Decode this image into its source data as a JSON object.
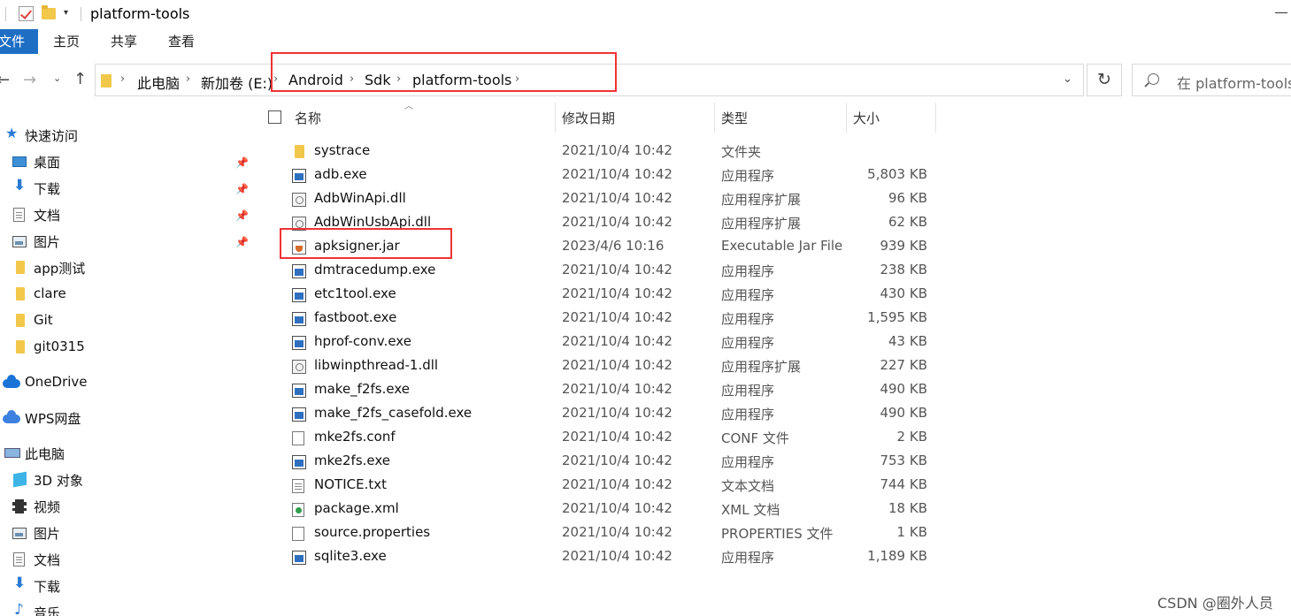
{
  "window": {
    "title": "platform-tools"
  },
  "ribbon": {
    "file": "文件",
    "home": "主页",
    "share": "共享",
    "view": "查看"
  },
  "address": {
    "crumbs": [
      "此电脑",
      "新加卷 (E:)",
      "Android",
      "Sdk",
      "platform-tools"
    ]
  },
  "search": {
    "placeholder": "在 platform-tools"
  },
  "sidebar": {
    "quick_access": "快速访问",
    "items": [
      {
        "label": "桌面"
      },
      {
        "label": "下载"
      },
      {
        "label": "文档"
      },
      {
        "label": "图片"
      },
      {
        "label": "app测试"
      },
      {
        "label": "clare"
      },
      {
        "label": "Git"
      },
      {
        "label": "git0315"
      }
    ],
    "onedrive": "OneDrive",
    "wps": "WPS网盘",
    "this_pc": "此电脑",
    "pc_items": [
      {
        "label": "3D 对象"
      },
      {
        "label": "视频"
      },
      {
        "label": "图片"
      },
      {
        "label": "文档"
      },
      {
        "label": "下载"
      },
      {
        "label": "音乐"
      }
    ]
  },
  "columns": {
    "name": "名称",
    "date": "修改日期",
    "type": "类型",
    "size": "大小"
  },
  "files": [
    {
      "name": "systrace",
      "date": "2021/10/4 10:42",
      "type": "文件夹",
      "size": "",
      "icon": "folder-icon"
    },
    {
      "name": "adb.exe",
      "date": "2021/10/4 10:42",
      "type": "应用程序",
      "size": "5,803 KB",
      "icon": "exe-icon"
    },
    {
      "name": "AdbWinApi.dll",
      "date": "2021/10/4 10:42",
      "type": "应用程序扩展",
      "size": "96 KB",
      "icon": "dll-icon"
    },
    {
      "name": "AdbWinUsbApi.dll",
      "date": "2021/10/4 10:42",
      "type": "应用程序扩展",
      "size": "62 KB",
      "icon": "dll-icon"
    },
    {
      "name": "apksigner.jar",
      "date": "2023/4/6 10:16",
      "type": "Executable Jar File",
      "size": "939 KB",
      "icon": "jar-icon"
    },
    {
      "name": "dmtracedump.exe",
      "date": "2021/10/4 10:42",
      "type": "应用程序",
      "size": "238 KB",
      "icon": "exe-icon"
    },
    {
      "name": "etc1tool.exe",
      "date": "2021/10/4 10:42",
      "type": "应用程序",
      "size": "430 KB",
      "icon": "exe-icon"
    },
    {
      "name": "fastboot.exe",
      "date": "2021/10/4 10:42",
      "type": "应用程序",
      "size": "1,595 KB",
      "icon": "exe-icon"
    },
    {
      "name": "hprof-conv.exe",
      "date": "2021/10/4 10:42",
      "type": "应用程序",
      "size": "43 KB",
      "icon": "exe-icon"
    },
    {
      "name": "libwinpthread-1.dll",
      "date": "2021/10/4 10:42",
      "type": "应用程序扩展",
      "size": "227 KB",
      "icon": "dll-icon"
    },
    {
      "name": "make_f2fs.exe",
      "date": "2021/10/4 10:42",
      "type": "应用程序",
      "size": "490 KB",
      "icon": "exe-icon"
    },
    {
      "name": "make_f2fs_casefold.exe",
      "date": "2021/10/4 10:42",
      "type": "应用程序",
      "size": "490 KB",
      "icon": "exe-icon"
    },
    {
      "name": "mke2fs.conf",
      "date": "2021/10/4 10:42",
      "type": "CONF 文件",
      "size": "2 KB",
      "icon": "blank-file-icon"
    },
    {
      "name": "mke2fs.exe",
      "date": "2021/10/4 10:42",
      "type": "应用程序",
      "size": "753 KB",
      "icon": "exe-icon"
    },
    {
      "name": "NOTICE.txt",
      "date": "2021/10/4 10:42",
      "type": "文本文档",
      "size": "744 KB",
      "icon": "txt-icon"
    },
    {
      "name": "package.xml",
      "date": "2021/10/4 10:42",
      "type": "XML 文档",
      "size": "18 KB",
      "icon": "xml-icon"
    },
    {
      "name": "source.properties",
      "date": "2021/10/4 10:42",
      "type": "PROPERTIES 文件",
      "size": "1 KB",
      "icon": "blank-file-icon"
    },
    {
      "name": "sqlite3.exe",
      "date": "2021/10/4 10:42",
      "type": "应用程序",
      "size": "1,189 KB",
      "icon": "exe-icon"
    }
  ],
  "watermark": "CSDN @圈外人员",
  "colors": {
    "file_tab": "#1e6fc4",
    "highlight_box": "#e33333",
    "folder": "#f2c84b"
  }
}
